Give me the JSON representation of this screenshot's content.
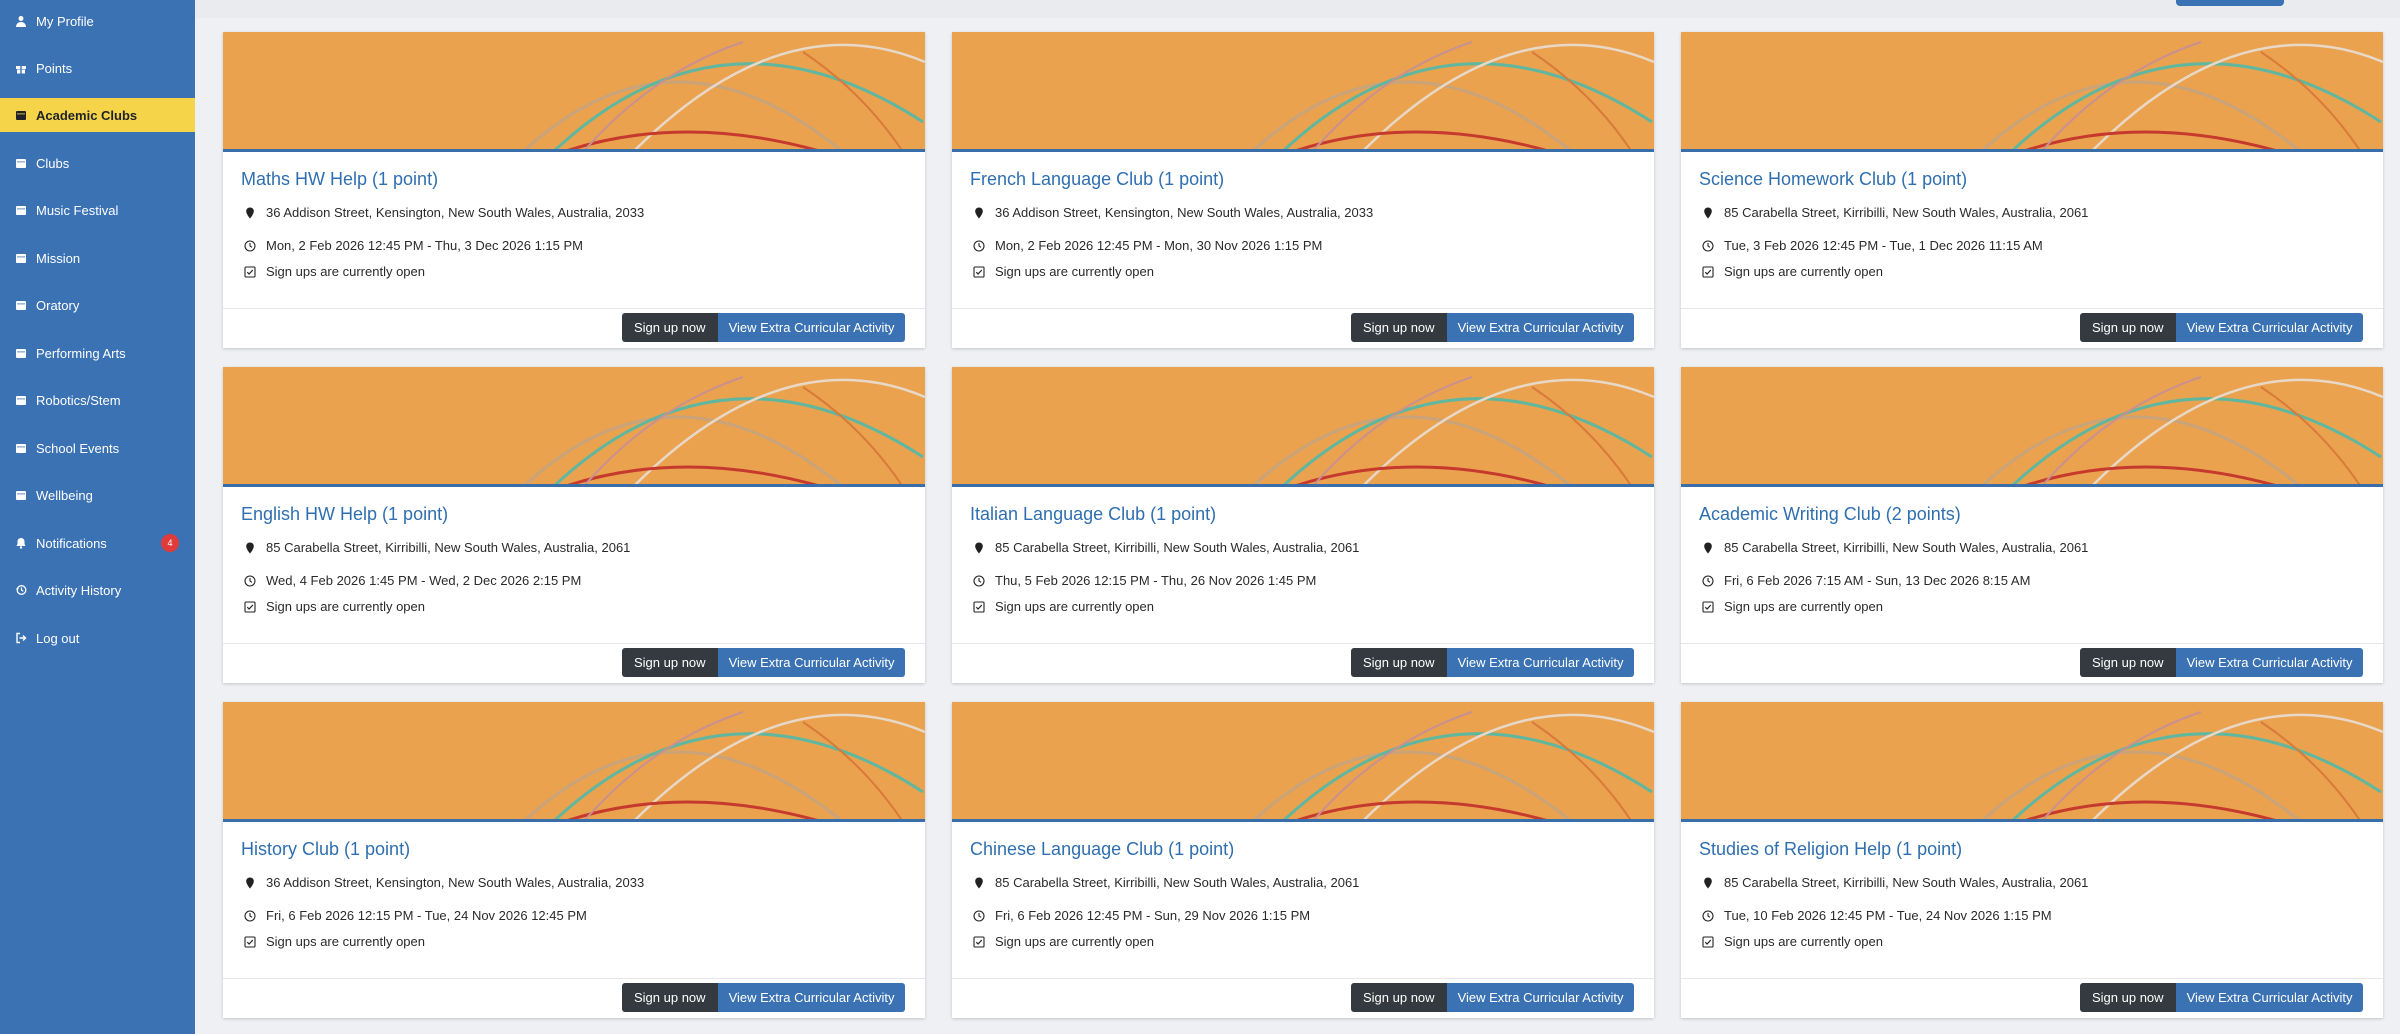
{
  "sidebar": {
    "items": [
      {
        "label": "My Profile",
        "icon": "user-icon",
        "active": false
      },
      {
        "label": "Points",
        "icon": "gift-icon",
        "active": false
      },
      {
        "label": "Academic Clubs",
        "icon": "calendar-icon",
        "active": true
      },
      {
        "label": "Clubs",
        "icon": "calendar-icon",
        "active": false
      },
      {
        "label": "Music Festival",
        "icon": "calendar-icon",
        "active": false
      },
      {
        "label": "Mission",
        "icon": "calendar-icon",
        "active": false
      },
      {
        "label": "Oratory",
        "icon": "calendar-icon",
        "active": false
      },
      {
        "label": "Performing Arts",
        "icon": "calendar-icon",
        "active": false
      },
      {
        "label": "Robotics/Stem",
        "icon": "calendar-icon",
        "active": false
      },
      {
        "label": "School Events",
        "icon": "calendar-icon",
        "active": false
      },
      {
        "label": "Wellbeing",
        "icon": "calendar-icon",
        "active": false
      },
      {
        "label": "Notifications",
        "icon": "bell-icon",
        "active": false,
        "badge": "4"
      },
      {
        "label": "Activity History",
        "icon": "history-icon",
        "active": false
      },
      {
        "label": "Log out",
        "icon": "logout-icon",
        "active": false
      }
    ]
  },
  "buttons": {
    "signup_label": "Sign up now",
    "view_label": "View Extra Curricular Activity"
  },
  "colors": {
    "sidebar": "#3a72b4",
    "active_item": "#f6d44a",
    "banner": "#eaa24f",
    "title_link": "#2f6fb0",
    "signup_button": "#343a40",
    "view_button": "#3a72b4",
    "badge": "#e03b3b"
  },
  "cards": [
    {
      "title": "Maths HW Help (1 point)",
      "location": "36 Addison Street, Kensington, New South Wales, Australia, 2033",
      "time": "Mon, 2 Feb 2026 12:45 PM - Thu, 3 Dec 2026 1:15 PM",
      "status": "Sign ups are currently open"
    },
    {
      "title": "French Language Club (1 point)",
      "location": "36 Addison Street, Kensington, New South Wales, Australia, 2033",
      "time": "Mon, 2 Feb 2026 12:45 PM - Mon, 30 Nov 2026 1:15 PM",
      "status": "Sign ups are currently open"
    },
    {
      "title": "Science Homework Club (1 point)",
      "location": "85 Carabella Street, Kirribilli, New South Wales, Australia, 2061",
      "time": "Tue, 3 Feb 2026 12:45 PM - Tue, 1 Dec 2026 11:15 AM",
      "status": "Sign ups are currently open"
    },
    {
      "title": "English HW Help (1 point)",
      "location": "85 Carabella Street, Kirribilli, New South Wales, Australia, 2061",
      "time": "Wed, 4 Feb 2026 1:45 PM - Wed, 2 Dec 2026 2:15 PM",
      "status": "Sign ups are currently open"
    },
    {
      "title": "Italian Language Club (1 point)",
      "location": "85 Carabella Street, Kirribilli, New South Wales, Australia, 2061",
      "time": "Thu, 5 Feb 2026 12:15 PM - Thu, 26 Nov 2026 1:45 PM",
      "status": "Sign ups are currently open"
    },
    {
      "title": "Academic Writing Club (2 points)",
      "location": "85 Carabella Street, Kirribilli, New South Wales, Australia, 2061",
      "time": "Fri, 6 Feb 2026 7:15 AM - Sun, 13 Dec 2026 8:15 AM",
      "status": "Sign ups are currently open"
    },
    {
      "title": "History Club (1 point)",
      "location": "36 Addison Street, Kensington, New South Wales, Australia, 2033",
      "time": "Fri, 6 Feb 2026 12:15 PM - Tue, 24 Nov 2026 12:45 PM",
      "status": "Sign ups are currently open"
    },
    {
      "title": "Chinese Language Club (1 point)",
      "location": "85 Carabella Street, Kirribilli, New South Wales, Australia, 2061",
      "time": "Fri, 6 Feb 2026 12:45 PM - Sun, 29 Nov 2026 1:15 PM",
      "status": "Sign ups are currently open"
    },
    {
      "title": "Studies of Religion Help (1 point)",
      "location": "85 Carabella Street, Kirribilli, New South Wales, Australia, 2061",
      "time": "Tue, 10 Feb 2026 12:45 PM - Tue, 24 Nov 2026 1:15 PM",
      "status": "Sign ups are currently open"
    }
  ]
}
